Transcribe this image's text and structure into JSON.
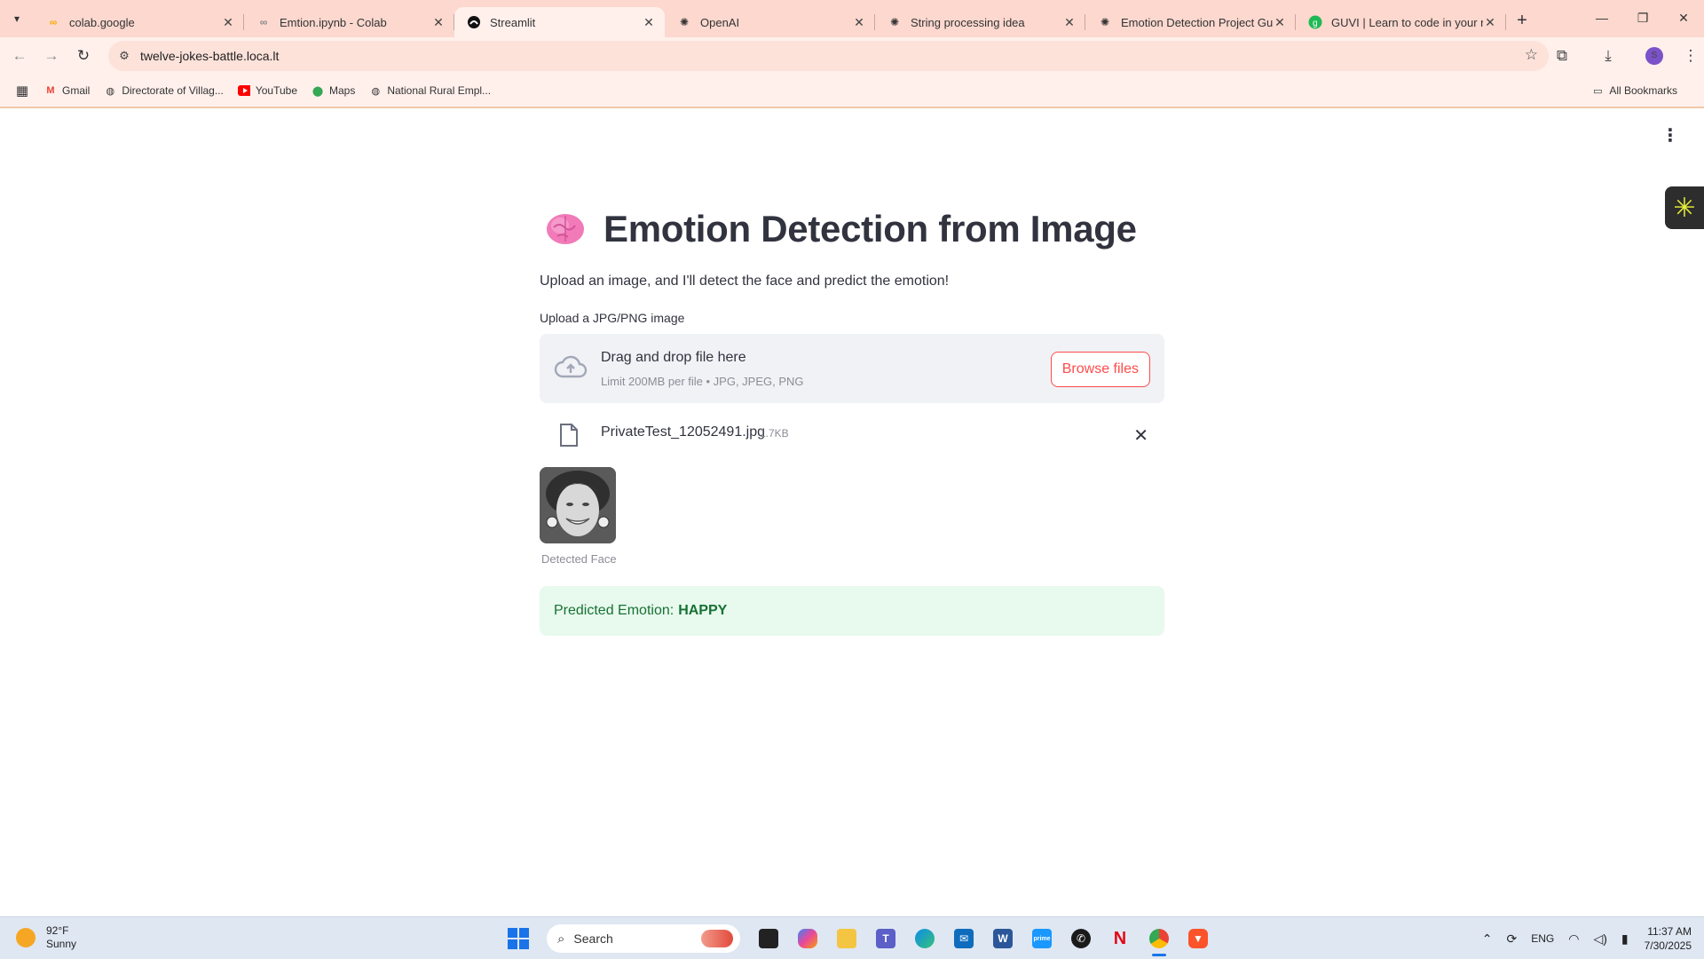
{
  "browser": {
    "tabs": [
      {
        "title": "colab.google",
        "icon": "colab-icon",
        "active": false
      },
      {
        "title": "Emtion.ipynb - Colab",
        "icon": "colab-icon",
        "active": false
      },
      {
        "title": "Streamlit",
        "icon": "streamlit-icon",
        "active": true
      },
      {
        "title": "OpenAI",
        "icon": "openai-icon",
        "active": false
      },
      {
        "title": "String processing idea",
        "icon": "openai-icon",
        "active": false
      },
      {
        "title": "Emotion Detection Project Guid",
        "icon": "openai-icon",
        "active": false
      },
      {
        "title": "GUVI | Learn to code in your na",
        "icon": "guvi-icon",
        "active": false
      }
    ],
    "url": "twelve-jokes-battle.loca.lt",
    "avatar_letter": "S",
    "bookmarks": [
      {
        "label": "Gmail",
        "icon": "gmail-icon"
      },
      {
        "label": "Directorate of Villag...",
        "icon": "globe-icon"
      },
      {
        "label": "YouTube",
        "icon": "youtube-icon"
      },
      {
        "label": "Maps",
        "icon": "maps-icon"
      },
      {
        "label": "National Rural Empl...",
        "icon": "globe-icon"
      }
    ],
    "all_bookmarks": "All Bookmarks"
  },
  "app": {
    "title": "Emotion Detection from Image",
    "subtitle": "Upload an image, and I'll detect the face and predict the emotion!",
    "uploader": {
      "label": "Upload a JPG/PNG image",
      "drop_title": "Drag and drop file here",
      "limit": "Limit 200MB per file • JPG, JPEG, PNG",
      "browse_label": "Browse files"
    },
    "file": {
      "name": "PrivateTest_12052491.jpg",
      "size": "1.7KB"
    },
    "face_caption": "Detected Face",
    "result": {
      "prefix": "Predicted Emotion:",
      "emotion": "HAPPY"
    }
  },
  "taskbar": {
    "temperature": "92°F",
    "condition": "Sunny",
    "search_placeholder": "Search",
    "language": "ENG",
    "time": "11:37 AM",
    "date": "7/30/2025"
  },
  "colors": {
    "accent": "#ff4b4b",
    "success_bg": "#e8f9ee",
    "success_text": "#177233",
    "chrome_tab_bg": "#fcd8cf"
  }
}
